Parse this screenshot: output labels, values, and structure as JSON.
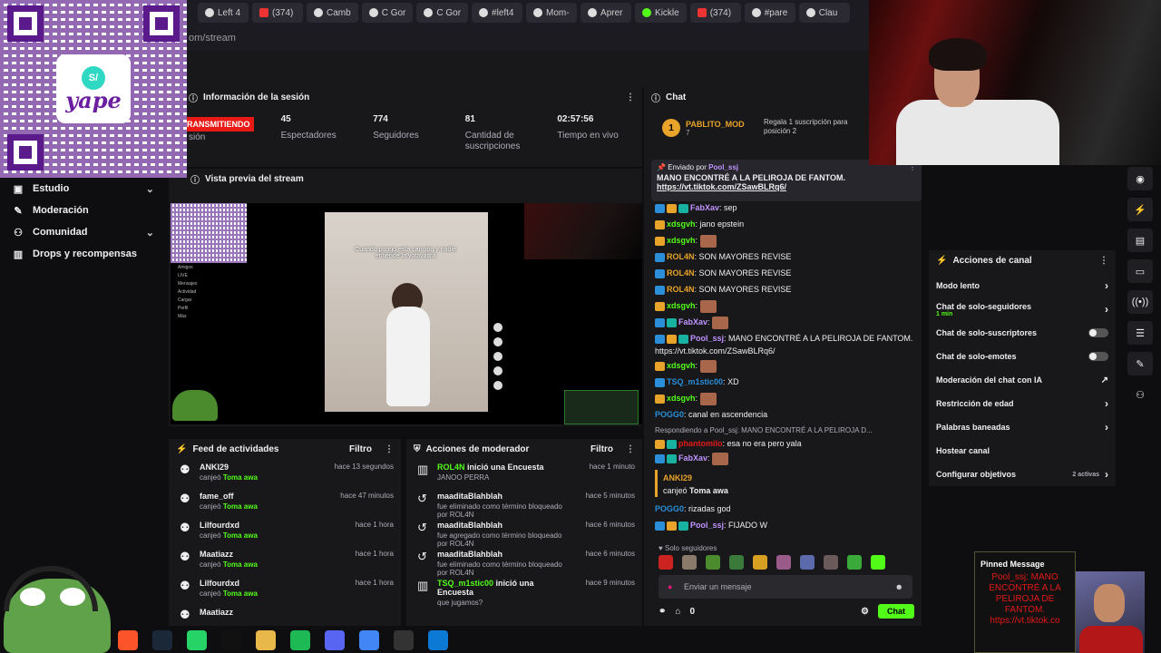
{
  "browser": {
    "tabs": [
      {
        "label": "Left 4",
        "icon": "tiktok-icon"
      },
      {
        "label": "(374)",
        "icon": "youtube-icon"
      },
      {
        "label": "Camb",
        "icon": "tiktok-icon"
      },
      {
        "label": "C Gor",
        "icon": "tiktok-icon"
      },
      {
        "label": "C Gor",
        "icon": "tiktok-icon"
      },
      {
        "label": "#left4",
        "icon": "tiktok-icon"
      },
      {
        "label": "Mom-",
        "icon": "tiktok-icon"
      },
      {
        "label": "Aprer",
        "icon": "tiktok-icon"
      },
      {
        "label": "Kickle",
        "icon": "kick-icon"
      },
      {
        "label": "(374)",
        "icon": "youtube-icon"
      },
      {
        "label": "#pare",
        "icon": "tiktok-icon"
      },
      {
        "label": "Clau",
        "icon": "tiktok-icon"
      }
    ],
    "url": "om/stream"
  },
  "overlay_qr": {
    "sol_glyph": "S/",
    "brand": "yape"
  },
  "nav": {
    "items": [
      {
        "label": "Estudio",
        "icon": "home-icon",
        "chevron": true
      },
      {
        "label": "Moderación",
        "icon": "wrench-icon",
        "chevron": false
      },
      {
        "label": "Comunidad",
        "icon": "users-icon",
        "chevron": true
      },
      {
        "label": "Drops y recompensas",
        "icon": "gift-icon",
        "chevron": false
      }
    ]
  },
  "session": {
    "title": "Información de la sesión",
    "live_badge": "RANSMITIENDO",
    "live_sub": "sión",
    "stats": [
      {
        "value": "45",
        "label": "Espectadores"
      },
      {
        "value": "774",
        "label": "Seguidores"
      },
      {
        "value": "81",
        "label": "Cantidad de suscripciones"
      },
      {
        "value": "02:57:56",
        "label": "Tiempo en vivo"
      }
    ]
  },
  "preview": {
    "title": "Vista previa del stream",
    "caption": "Cuando pongo esta canción y nadie entiende la yotavaitra",
    "side_items": [
      "Amigos",
      "LIVE",
      "Mensajes",
      "Actividad",
      "Cargar",
      "Perfil",
      "Más"
    ]
  },
  "feed": {
    "title": "Feed de actividades",
    "filter": "Filtro",
    "items": [
      {
        "name": "ANKI29",
        "time": "hace 13 segundos",
        "action": "canjeó",
        "reward": "Toma awa"
      },
      {
        "name": "fame_off",
        "time": "hace 47 minutos",
        "action": "canjeó",
        "reward": "Toma awa"
      },
      {
        "name": "Lilfourdxd",
        "time": "hace 1 hora",
        "action": "canjeó",
        "reward": "Toma awa"
      },
      {
        "name": "Maatiazz",
        "time": "hace 1 hora",
        "action": "canjeó",
        "reward": "Toma awa"
      },
      {
        "name": "Lilfourdxd",
        "time": "hace 1 hora",
        "action": "canjeó",
        "reward": "Toma awa"
      },
      {
        "name": "Maatiazz",
        "time": "",
        "action": "",
        "reward": ""
      }
    ]
  },
  "modactions": {
    "title": "Acciones de moderador",
    "filter": "Filtro",
    "items": [
      {
        "title": "ROL4N inició una Encuesta",
        "title_user": "ROL4N",
        "title_rest": " inició una Encuesta",
        "sub": "JANOO PERRA",
        "time": "hace 1 minuto",
        "icon": "poll-icon"
      },
      {
        "title": "maaditaBlahblah",
        "title_user": "maaditaBlahblah",
        "title_rest": "",
        "sub": "fue eliminado como término bloqueado por ROL4N",
        "time": "hace 5 minutos",
        "icon": "undo-icon"
      },
      {
        "title": "maaditaBlahblah",
        "title_user": "maaditaBlahblah",
        "title_rest": "",
        "sub": "fue agregado como término bloqueado por ROL4N",
        "time": "hace 6 minutos",
        "icon": "undo-icon"
      },
      {
        "title": "maaditaBlahblah",
        "title_user": "maaditaBlahblah",
        "title_rest": "",
        "sub": "fue eliminado como término bloqueado por ROL4N",
        "time": "hace 6 minutos",
        "icon": "undo-icon"
      },
      {
        "title": "TSQ_m1stic00 inició una Encuesta",
        "title_user": "TSQ_m1stic00",
        "title_rest": " inició una Encuesta",
        "sub": "que jugamos?",
        "time": "hace 9 minutos",
        "icon": "poll-icon"
      }
    ]
  },
  "chat": {
    "title": "Chat",
    "gift_user": "PABLITO_MOD",
    "gift_badge": "1",
    "gift_count": "7",
    "gift_desc": "Regala 1 suscripción para posición 2",
    "pinned": {
      "label": "Enviado por",
      "user": "Pool_ssj",
      "message": "MANO ENCONTRÉ A LA PELIROJA DE FANTOM.",
      "link": "https://vt.tiktok.com/ZSawBLRq6/"
    },
    "messages": [
      {
        "user": "FabXav",
        "color": "#bf94ff",
        "text": "sep",
        "badges": [
          "b",
          "y",
          "g"
        ]
      },
      {
        "user": "xdsgvh",
        "color": "#53fc18",
        "text": "jano epstein",
        "badges": [
          "y"
        ]
      },
      {
        "user": "xdsgvh",
        "color": "#53fc18",
        "text": "",
        "emote": true,
        "badges": [
          "y"
        ]
      },
      {
        "user": "ROL4N",
        "color": "#e7a32a",
        "text": "SON MAYORES REVISE",
        "badges": [
          "b"
        ]
      },
      {
        "user": "ROL4N",
        "color": "#e7a32a",
        "text": "SON MAYORES REVISE",
        "badges": [
          "b"
        ]
      },
      {
        "user": "ROL4N",
        "color": "#e7a32a",
        "text": "SON MAYORES REVISE",
        "badges": [
          "b"
        ]
      },
      {
        "user": "xdsgvh",
        "color": "#53fc18",
        "text": "",
        "emote": true,
        "badges": [
          "y"
        ]
      },
      {
        "user": "FabXav",
        "color": "#bf94ff",
        "text": "",
        "emote": true,
        "badges": [
          "b",
          "g"
        ]
      },
      {
        "user": "Pool_ssj",
        "color": "#bf94ff",
        "text": "MANO ENCONTRÉ A LA PELIROJA DE FANTOM. https://vt.tiktok.com/ZSawBLRq6/",
        "badges": [
          "b",
          "y",
          "g"
        ]
      },
      {
        "user": "xdsgvh",
        "color": "#53fc18",
        "text": "",
        "emote": true,
        "badges": [
          "y"
        ]
      },
      {
        "user": "TSQ_m1stic00",
        "color": "#2a8fd8",
        "text": "XD",
        "badges": [
          "b"
        ]
      },
      {
        "user": "xdsgvh",
        "color": "#53fc18",
        "text": "",
        "emote": true,
        "badges": [
          "y"
        ]
      },
      {
        "user": "POGG0",
        "color": "#2a8fd8",
        "text": "canal en ascendencia",
        "badges": []
      },
      {
        "user": "phantomilo",
        "color": "#e41818",
        "text": "esa no era pero yala",
        "badges": [
          "y",
          "g"
        ],
        "reply": "Respondiendo a Pool_ssj: MANO ENCONTRÉ A LA PELIROJA D..."
      },
      {
        "user": "FabXav",
        "color": "#bf94ff",
        "text": "",
        "emote": true,
        "badges": [
          "b",
          "g"
        ]
      }
    ],
    "redeem": {
      "user": "ANKI29",
      "text": "canjeó",
      "reward": "Toma awa"
    },
    "late": [
      {
        "user": "POGG0",
        "color": "#2a8fd8",
        "text": "rizadas god",
        "badges": []
      },
      {
        "user": "Pool_ssj",
        "color": "#bf94ff",
        "text": "FIJADO W",
        "badges": [
          "b",
          "y",
          "g"
        ]
      }
    ],
    "slow_label": "Solo seguidores",
    "input_placeholder": "Enviar un mensaje",
    "viewer_count": "0",
    "send_label": "Chat"
  },
  "channel_actions": {
    "title": "Acciones de canal",
    "items": [
      {
        "label": "Modo lento",
        "type": "arrow"
      },
      {
        "label": "Chat de solo-seguidores",
        "sub": "1 min",
        "type": "arrow"
      },
      {
        "label": "Chat de solo-suscriptores",
        "type": "toggle"
      },
      {
        "label": "Chat de solo-emotes",
        "type": "toggle"
      },
      {
        "label": "Moderación del chat con IA",
        "type": "ext"
      },
      {
        "label": "Restricción de edad",
        "type": "arrow"
      },
      {
        "label": "Palabras baneadas",
        "type": "arrow"
      },
      {
        "label": "Hostear canal",
        "type": "none"
      },
      {
        "label": "Configurar objetivos",
        "sub": "2 activas",
        "type": "arrow"
      }
    ]
  },
  "pinned_overlay": {
    "title": "Pinned Message",
    "body": "Pool_ssj: MANO ENCONTRÉ A LA PELIROJA DE FANTOM. https://vt.tiktok.co"
  },
  "taskbar": [
    "brave-icon",
    "steam-icon",
    "whatsapp-icon",
    "tiktok-icon",
    "folder-icon",
    "spotify-icon",
    "discord-icon",
    "chrome-icon",
    "obs-icon",
    "edge-icon"
  ],
  "colors": {
    "accent": "#53fc18",
    "live": "#e91916",
    "bg": "#0e0e10",
    "panel": "#18181b"
  }
}
